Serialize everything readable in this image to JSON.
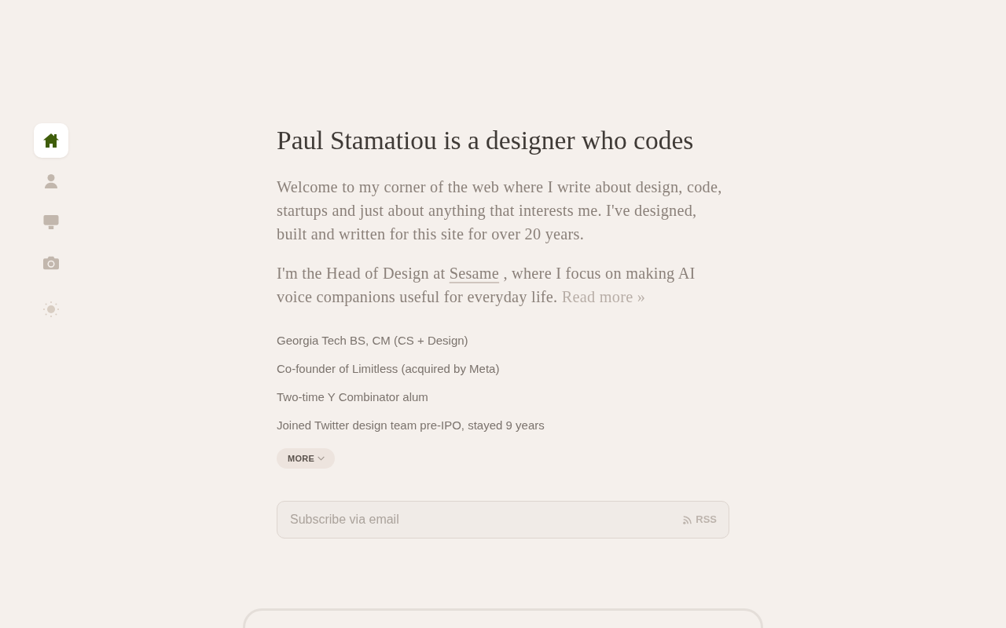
{
  "sidebar": {
    "items": [
      {
        "kind": "home",
        "selected": true
      },
      {
        "kind": "person",
        "selected": false
      },
      {
        "kind": "monitor",
        "selected": false
      },
      {
        "kind": "camera",
        "selected": false
      }
    ]
  },
  "main": {
    "heading": "Paul Stamatiou is a designer who codes",
    "paragraphs": [
      {
        "segments": [
          {
            "kind": "text",
            "text": "Welcome to my corner of the web where I write about design, code, startups and just about anything that interests me. I've designed, built and written for this site for over 20 years."
          }
        ]
      },
      {
        "segments": [
          {
            "kind": "text",
            "text": "I'm the Head of Design at "
          },
          {
            "kind": "link",
            "text": "Sesame"
          },
          {
            "kind": "text",
            "text": " , where I focus on making AI voice companions useful for everyday life. "
          },
          {
            "kind": "more",
            "text": "Read more »"
          }
        ]
      }
    ],
    "facts": [
      "Georgia Tech BS, CM (CS + Design)",
      "Co-founder of Limitless (acquired by Meta)",
      "Two-time Y Combinator alum",
      "Joined Twitter design team pre-IPO, stayed 9 years"
    ],
    "more_button": {
      "label": "MORE"
    },
    "subscribe": {
      "placeholder": "Subscribe via email",
      "rss_label": "RSS"
    }
  }
}
